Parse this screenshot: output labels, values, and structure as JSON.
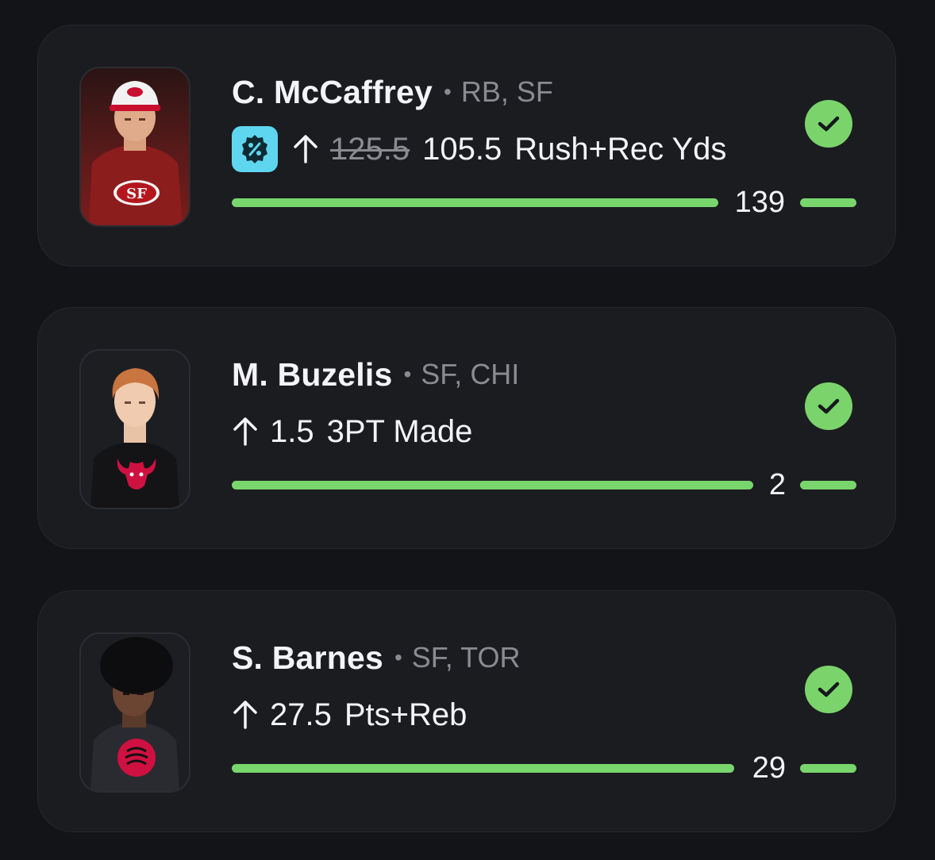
{
  "picks": [
    {
      "player_name": "C. McCaffrey",
      "separator": "•",
      "meta": "RB, SF",
      "has_promo": true,
      "promo_icon": "percent-badge-icon",
      "direction_icon": "arrow-up-icon",
      "original_line": "125.5",
      "line": "105.5",
      "stat": "Rush+Rec Yds",
      "result": "139",
      "status": "won",
      "status_icon": "checkmark-icon",
      "team_logo": "49ers-logo",
      "accent_color": "#79d66d"
    },
    {
      "player_name": "M. Buzelis",
      "separator": "•",
      "meta": "SF, CHI",
      "has_promo": false,
      "direction_icon": "arrow-up-icon",
      "line": "1.5",
      "stat": "3PT Made",
      "result": "2",
      "status": "won",
      "status_icon": "checkmark-icon",
      "team_logo": "bulls-logo",
      "accent_color": "#79d66d"
    },
    {
      "player_name": "S. Barnes",
      "separator": "•",
      "meta": "SF, TOR",
      "has_promo": false,
      "direction_icon": "arrow-up-icon",
      "line": "27.5",
      "stat": "Pts+Reb",
      "result": "29",
      "status": "won",
      "status_icon": "checkmark-icon",
      "team_logo": "raptors-logo",
      "accent_color": "#79d66d"
    }
  ]
}
